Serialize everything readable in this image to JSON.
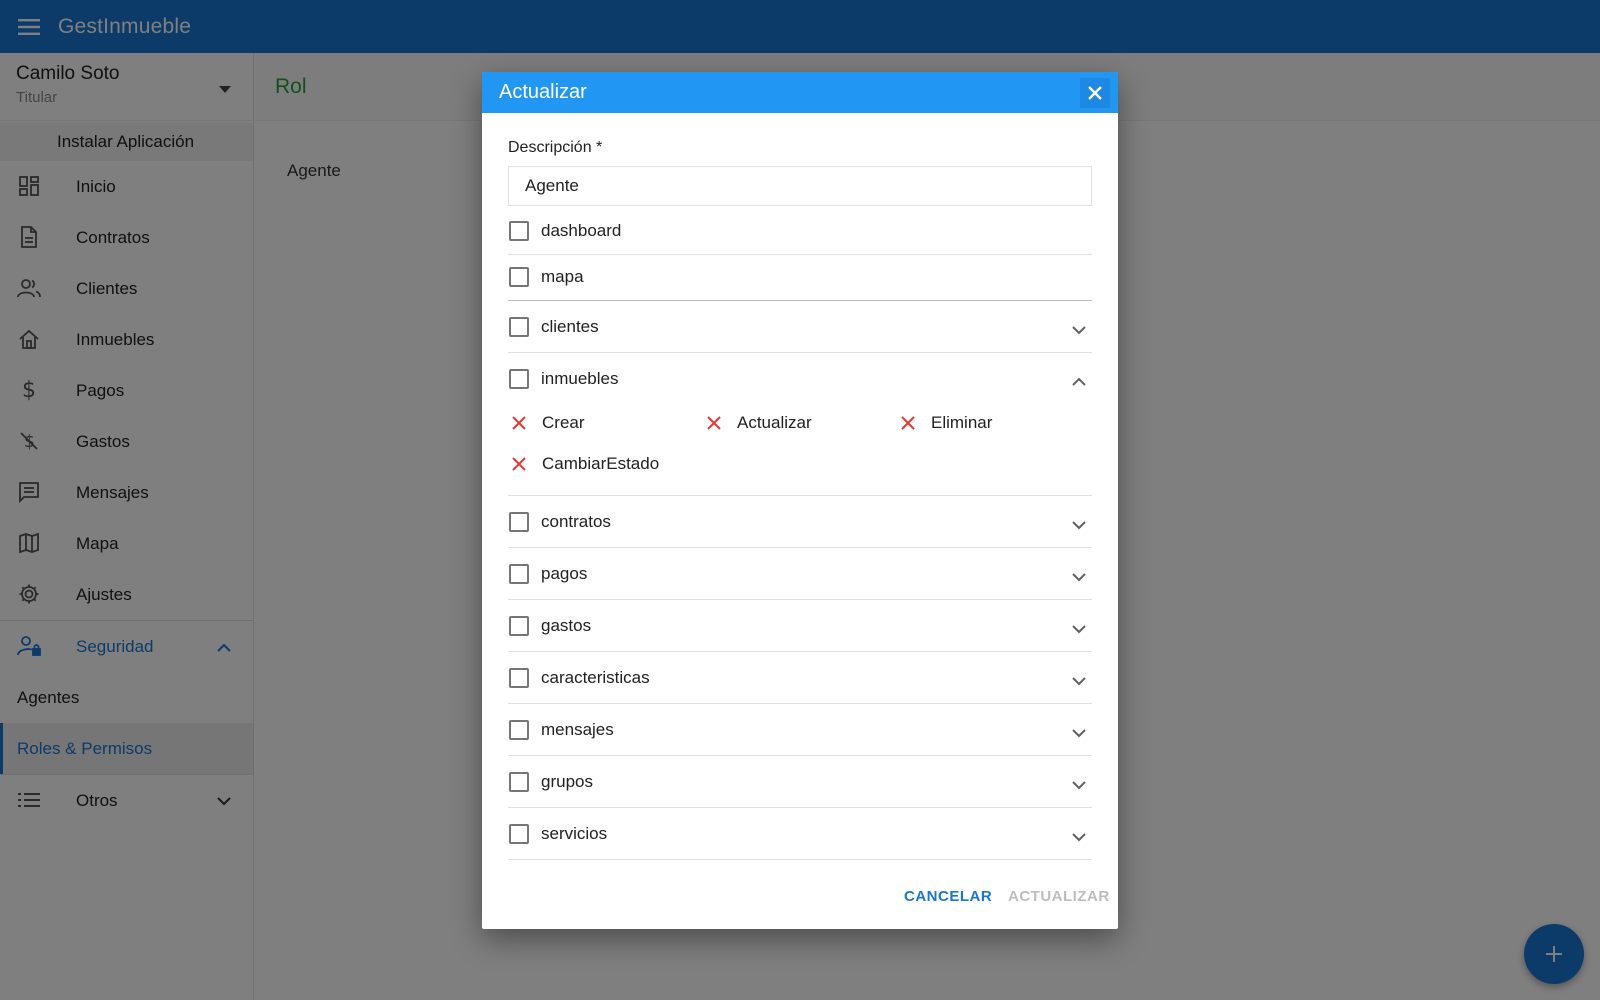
{
  "app": {
    "title": "GestInmueble"
  },
  "user": {
    "name": "Camilo Soto",
    "role": "Titular"
  },
  "sidebar": {
    "install_label": "Instalar Aplicación",
    "items": [
      {
        "label": "Inicio",
        "icon": "dashboard-icon"
      },
      {
        "label": "Contratos",
        "icon": "document-icon"
      },
      {
        "label": "Clientes",
        "icon": "people-icon"
      },
      {
        "label": "Inmuebles",
        "icon": "home-icon"
      },
      {
        "label": "Pagos",
        "icon": "dollar-icon"
      },
      {
        "label": "Gastos",
        "icon": "money-off-icon"
      },
      {
        "label": "Mensajes",
        "icon": "message-icon"
      },
      {
        "label": "Mapa",
        "icon": "map-icon"
      },
      {
        "label": "Ajustes",
        "icon": "gear-icon"
      }
    ],
    "security": {
      "label": "Seguridad",
      "sub": [
        "Agentes",
        "Roles & Permisos"
      ]
    },
    "others": {
      "label": "Otros"
    }
  },
  "main": {
    "title": "Rol",
    "items": [
      "Agente"
    ]
  },
  "dialog": {
    "title": "Actualizar",
    "description_label": "Descripción *",
    "description_value": "Agente",
    "permissions": [
      "dashboard",
      "mapa",
      "clientes",
      "inmuebles",
      "contratos",
      "pagos",
      "gastos",
      "caracteristicas",
      "mensajes",
      "grupos",
      "servicios"
    ],
    "inmuebles_actions": [
      "Crear",
      "Actualizar",
      "Eliminar",
      "CambiarEstado"
    ],
    "cancel_label": "CANCELAR",
    "update_label": "ACTUALIZAR"
  },
  "colors": {
    "primary": "#1976d2",
    "dialog_header": "#2196f3",
    "title_green": "#2e9d3a",
    "denied_red": "#e53935"
  }
}
